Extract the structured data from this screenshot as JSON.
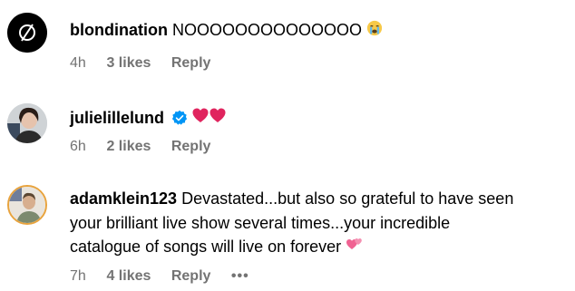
{
  "comments": [
    {
      "username": "blondination",
      "text": "NOOOOOOOOOOOOOO",
      "emoji": "crying-face-icon",
      "time": "4h",
      "likes": "3 likes",
      "reply": "Reply"
    },
    {
      "username": "julielillelund",
      "verified": true,
      "text": "",
      "emoji": "two-red-hearts-icon",
      "time": "6h",
      "likes": "2 likes",
      "reply": "Reply"
    },
    {
      "username": "adamklein123",
      "text_line1": "Devastated...but also so grateful to have seen",
      "text_line2": "your brilliant live show several times...your incredible",
      "text_line3": "catalogue of songs will live on forever",
      "emoji": "two-pink-hearts-icon",
      "time": "7h",
      "likes": "4 likes",
      "reply": "Reply",
      "more": "•••"
    }
  ],
  "colors": {
    "meta_text": "#737373",
    "verified_blue": "#0095f6",
    "heart_red": "#e0245e",
    "pink_heart": "#f06292"
  }
}
